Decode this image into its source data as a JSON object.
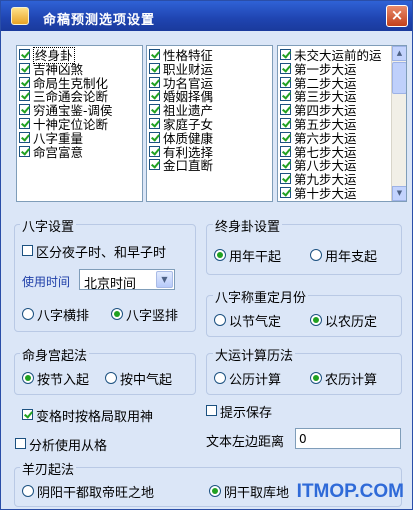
{
  "window": {
    "title": "命稿预测选项设置",
    "close_label": "×"
  },
  "list1": [
    {
      "label": "终身卦",
      "checked": true
    },
    {
      "label": "吉神凶煞",
      "checked": true
    },
    {
      "label": "命局生克制化",
      "checked": true
    },
    {
      "label": "三命通会论断",
      "checked": true
    },
    {
      "label": "穷通宝鉴-调侯",
      "checked": true
    },
    {
      "label": "十神定位论断",
      "checked": true
    },
    {
      "label": "八字重量",
      "checked": true
    },
    {
      "label": "命宫富意",
      "checked": true
    }
  ],
  "list2": [
    {
      "label": "性格特征",
      "checked": true
    },
    {
      "label": "职业财运",
      "checked": true
    },
    {
      "label": "功名官运",
      "checked": true
    },
    {
      "label": "婚姻择偶",
      "checked": true
    },
    {
      "label": "祖业遗产",
      "checked": true
    },
    {
      "label": "家庭子女",
      "checked": true
    },
    {
      "label": "体质健康",
      "checked": true
    },
    {
      "label": "有利选择",
      "checked": true
    },
    {
      "label": "金口直断",
      "checked": true
    }
  ],
  "list3": [
    {
      "label": "未交大运前的运",
      "checked": true
    },
    {
      "label": "第一步大运",
      "checked": true
    },
    {
      "label": "第二步大运",
      "checked": true
    },
    {
      "label": "第三步大运",
      "checked": true
    },
    {
      "label": "第四步大运",
      "checked": true
    },
    {
      "label": "第五步大运",
      "checked": true
    },
    {
      "label": "第六步大运",
      "checked": true
    },
    {
      "label": "第七步大运",
      "checked": true
    },
    {
      "label": "第八步大运",
      "checked": true
    },
    {
      "label": "第九步大运",
      "checked": true
    },
    {
      "label": "第十步大运",
      "checked": true
    }
  ],
  "bazi": {
    "title": "八字设置",
    "night_check": "区分夜子时、和早子时",
    "time_label": "使用时间",
    "time_value": "北京时间",
    "horizontal": "八字横排",
    "vertical": "八字竖排"
  },
  "zhongshen": {
    "title": "终身卦设置",
    "year_gan": "用年干起",
    "year_zhi": "用年支起"
  },
  "bazi_month": {
    "title": "八字称重定月份",
    "jieqi": "以节气定",
    "lunar": "以农历定"
  },
  "minggong": {
    "title": "命身宫起法",
    "jieru": "按节入起",
    "zhongqi": "按中气起"
  },
  "dayun": {
    "title": "大运计算历法",
    "gongli": "公历计算",
    "nongli": "农历计算"
  },
  "misc": {
    "bianshi": "变格时按格局取用神",
    "prompt_save": "提示保存",
    "congge": "分析使用从格",
    "left_margin_label": "文本左边距离",
    "left_margin_value": "0"
  },
  "yangren": {
    "title": "羊刃起法",
    "yang_gan": "阴阳干都取帝旺之地",
    "yin_gan": "阴干取库地"
  },
  "watermark": "ITMOP.COM"
}
